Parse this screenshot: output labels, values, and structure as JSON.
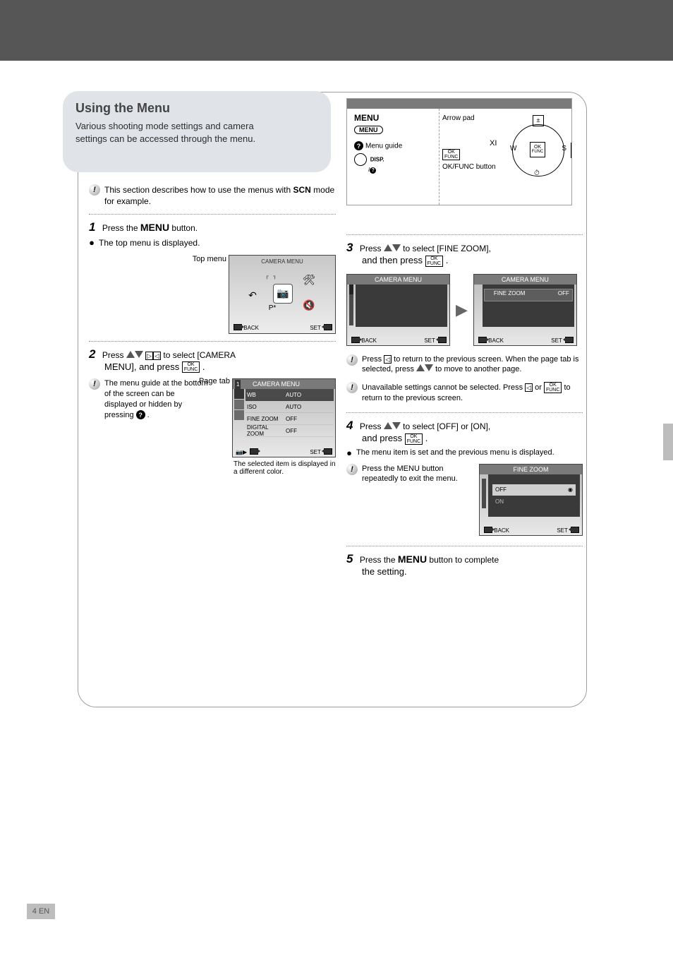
{
  "header": {
    "title": ""
  },
  "callout": {
    "title": "Using the Menu",
    "line1": "Various shooting mode settings and camera",
    "line2": "settings can be accessed through the menu."
  },
  "note_scn": {
    "prefix": "This section describes how to use the menus with",
    "scn": "SCN",
    "suffix": "mode for example."
  },
  "ref": {
    "menu_lbl": "MENU",
    "menu_btn": "MENU",
    "guide_label": "Menu guide",
    "disp": "DISP.",
    "disp2": "/",
    "okfunc_desc": "OK/FUNC button",
    "arrow_desc": "Arrow pad",
    "xi": "XI",
    "flower": "W",
    "bolt": "S"
  },
  "step1": {
    "num": "1",
    "text": "Press the ",
    "bold": "MENU",
    "text2": " button.",
    "bullet": "The top menu is displayed.",
    "thumb": {
      "title": "Top menu",
      "back_hint": "BACK",
      "set_hint": "SET",
      "icons": {
        "undo": "↶",
        "camera": "📷",
        "wrench": "🔧",
        "perfect": "P",
        "gears": "⚙"
      },
      "center_label": "CAMERA MENU",
      "pointer": "Top menu"
    }
  },
  "step2": {
    "num": "2",
    "pre": "Press ",
    "post": " to select [CAMERA",
    "line2": "MENU], and press ",
    "after": ".",
    "info": "The menu guide at the bottom of the screen can be displayed or hidden by pressing ",
    "thumb": {
      "title": "CAMERA MENU",
      "tnum": "1",
      "pointer": "Page tab",
      "rows": [
        {
          "k": "WB",
          "v": "AUTO"
        },
        {
          "k": "ISO",
          "v": "AUTO"
        },
        {
          "k": "FINE ZOOM",
          "v": "OFF"
        },
        {
          "k": "DIGITAL ZOOM",
          "v": "OFF"
        }
      ],
      "back_ico": "EXIT",
      "set_ico": "SET",
      "sel_note": "The selected item is displayed in a different color."
    }
  },
  "step3": {
    "num": "3",
    "pre": "Press ",
    "post": " to select [FINE ZOOM],",
    "line2": "and then press ",
    "after": ".",
    "pair": {
      "left": {
        "title": "CAMERA MENU",
        "back": "BACK",
        "set": "SET"
      },
      "right": {
        "title": "CAMERA MENU",
        "back": "BACK",
        "set": "SET",
        "sel": "FINE ZOOM",
        "val": "OFF"
      }
    },
    "info1_pre": "Press ",
    "info1_mid": " to return to the previous screen. When the page tab is selected, press ",
    "info1_post": " to move to another page.",
    "info2_pre": "Unavailable settings cannot be selected. Press ",
    "info2_post": " to return to the previous screen."
  },
  "step4": {
    "num": "4",
    "pre": "Press ",
    "post": " to select [OFF] or [ON],",
    "line2a": "and press ",
    "line2b": ".",
    "bullet": "The menu item is set and the previous menu is displayed.",
    "info": "Press the MENU button repeatedly to exit the menu.",
    "thumb": {
      "title": "FINE ZOOM",
      "sel": "OFF",
      "opt2": "ON",
      "back": "BACK",
      "set": "SET"
    }
  },
  "step5": {
    "num": "5",
    "pre": "Press the ",
    "bold": "MENU",
    "post": " button to complete",
    "line2": "the setting."
  },
  "page_number": "4",
  "book_section": "EN"
}
